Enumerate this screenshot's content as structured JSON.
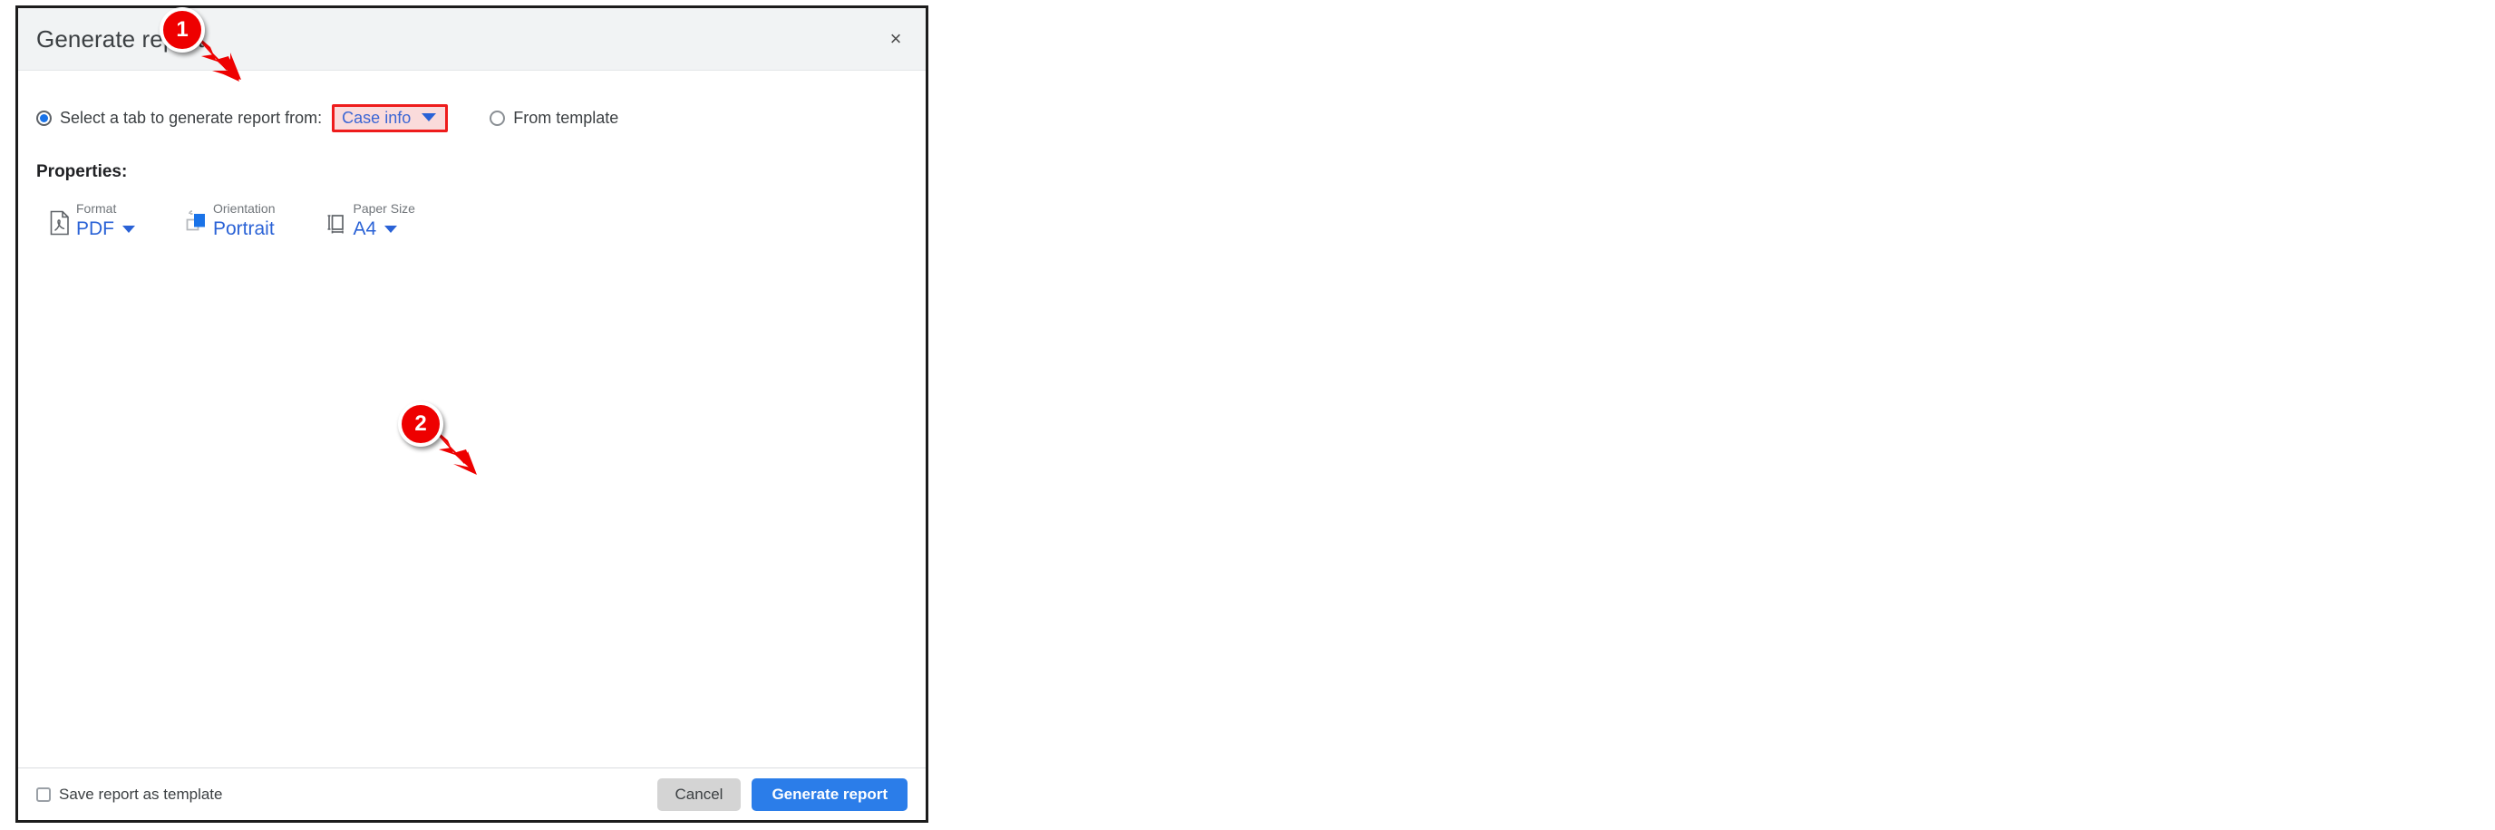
{
  "dialog": {
    "title": "Generate report",
    "close_icon": "close-icon",
    "close_label": "×"
  },
  "source": {
    "radio_tab": {
      "label": "Select a tab to generate report from:",
      "selected": true
    },
    "tab_dropdown": {
      "value": "Case info",
      "icon": "chevron-down-icon",
      "highlight_border_color": "#ee1c1c",
      "highlight_fill_color": "#fadbdb",
      "value_color": "#3b66d4"
    },
    "radio_template": {
      "label": "From template",
      "selected": false
    }
  },
  "properties": {
    "heading": "Properties:",
    "items": [
      {
        "icon": "pdf-document-icon",
        "label": "Format",
        "value": "PDF",
        "has_caret": true
      },
      {
        "icon": "page-orientation-icon",
        "label": "Orientation",
        "value": "Portrait",
        "has_caret": false
      },
      {
        "icon": "paper-size-icon",
        "label": "Paper Size",
        "value": "A4",
        "has_caret": true
      }
    ]
  },
  "footer": {
    "save_as_template": {
      "label": "Save report as template",
      "checked": false
    },
    "cancel_label": "Cancel",
    "generate_label": "Generate report"
  },
  "callouts": [
    {
      "number": "1"
    },
    {
      "number": "2"
    }
  ],
  "colors": {
    "accent_blue": "#2a62d6",
    "primary_button": "#2b7de9",
    "callout_red": "#ee0000",
    "titlebar_bg": "#f1f3f4"
  }
}
